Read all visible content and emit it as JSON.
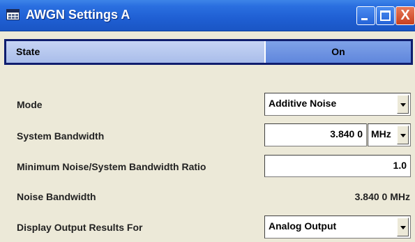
{
  "window": {
    "title": "AWGN Settings A",
    "title_icon": "window-menu-icon",
    "buttons": {
      "minimize_icon": "minimize-icon",
      "maximize_icon": "maximize-icon",
      "close_icon": "close-icon",
      "close_glyph": "X"
    }
  },
  "state": {
    "label": "State",
    "value": "On"
  },
  "mode": {
    "label": "Mode",
    "value": "Additive Noise"
  },
  "system_bandwidth": {
    "label": "System Bandwidth",
    "value": "3.840 0",
    "unit": "MHz"
  },
  "noise_ratio": {
    "label": "Minimum Noise/System Bandwidth Ratio",
    "value": "1.0"
  },
  "noise_bandwidth": {
    "label": "Noise Bandwidth",
    "value": "3.840 0 MHz"
  },
  "display_output": {
    "label": "Display Output Results For",
    "value": "Analog Output"
  },
  "colors": {
    "title_bar": "#1f5fd3",
    "state_frame": "#0f1d6e",
    "state_button": "#6f94e2",
    "panel_background": "#ece9d8"
  }
}
